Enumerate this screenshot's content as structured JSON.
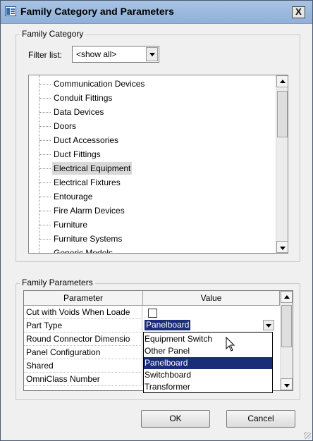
{
  "window": {
    "title": "Family Category and Parameters",
    "close_label": "X"
  },
  "family_category": {
    "group_label": "Family Category",
    "filter_label": "Filter list:",
    "filter_value": "<show all>",
    "items": [
      "Communication Devices",
      "Conduit Fittings",
      "Data Devices",
      "Doors",
      "Duct Accessories",
      "Duct Fittings",
      "Electrical Equipment",
      "Electrical Fixtures",
      "Entourage",
      "Fire Alarm Devices",
      "Furniture",
      "Furniture Systems",
      "Generic Models"
    ],
    "selected_item": "Electrical Equipment"
  },
  "family_parameters": {
    "group_label": "Family Parameters",
    "columns": [
      "Parameter",
      "Value"
    ],
    "rows": [
      {
        "name": "Cut with Voids When Loade",
        "value_type": "checkbox",
        "checked": false
      },
      {
        "name": "Part Type",
        "value": "Panelboard"
      },
      {
        "name": "Round Connector Dimensio",
        "value": ""
      },
      {
        "name": "Panel Configuration",
        "value": ""
      },
      {
        "name": "Shared",
        "value": ""
      },
      {
        "name": "OmniClass Number",
        "value": ""
      }
    ],
    "dropdown_options": [
      "Equipment Switch",
      "Other Panel",
      "Panelboard",
      "Switchboard",
      "Transformer"
    ],
    "dropdown_selected": "Panelboard"
  },
  "buttons": {
    "ok": "OK",
    "cancel": "Cancel"
  },
  "icons": [
    "family-icon",
    "close-icon",
    "chevron-down-icon",
    "scroll-up-icon",
    "scroll-down-icon",
    "mouse-cursor-icon",
    "resize-grip-icon"
  ],
  "colors": {
    "title_bar": "#a9c3e3",
    "selection": "#1b2c78",
    "tree_selection": "#d9d9d9"
  }
}
